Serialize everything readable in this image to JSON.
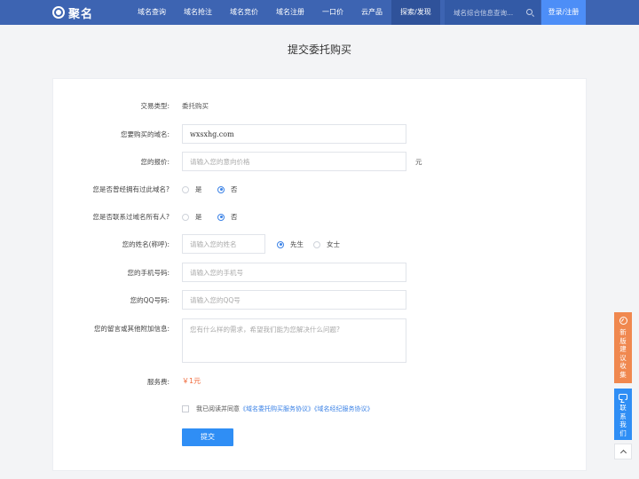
{
  "nav": {
    "logo_text": "聚名",
    "links": [
      "域名查询",
      "域名抢注",
      "域名竞价",
      "域名注册",
      "一口价",
      "云产品",
      "探索/发现"
    ],
    "search_placeholder": "域名综合信息查询...",
    "login_label": "登录/注册"
  },
  "page": {
    "title": "提交委托购买"
  },
  "form": {
    "trade_type_label": "交易类型:",
    "trade_type_value": "委托购买",
    "domain_label": "您要购买的域名:",
    "domain_value": "wxsxhg.com",
    "price_label": "您的报价:",
    "price_placeholder": "请输入您的意向价格",
    "price_unit": "元",
    "owned_label": "您是否曾经拥有过此域名?",
    "owned_options": [
      "是",
      "否"
    ],
    "owned_selected": "否",
    "contacted_label": "您是否联系过域名所有人?",
    "contacted_options": [
      "是",
      "否"
    ],
    "contacted_selected": "否",
    "name_label": "您的姓名(称呼):",
    "name_placeholder": "请输入您的姓名",
    "gender_options": [
      "先生",
      "女士"
    ],
    "gender_selected": "先生",
    "phone_label": "您的手机号码:",
    "phone_placeholder": "请输入您的手机号",
    "qq_label": "您的QQ号码:",
    "qq_placeholder": "请输入您的QQ号",
    "message_label": "您的留言或其他附加信息:",
    "message_placeholder": "您有什么样的需求，希望我们能为您解决什么问题?",
    "fee_label": "服务费:",
    "fee_value": "￥1元",
    "agree_prefix": "我已阅读并同意",
    "agree_link1": "《域名委托购买服务协议》",
    "agree_link2": "《域名经纪服务协议》",
    "agree_checked": false,
    "submit_label": "提交"
  },
  "sidebar_float": {
    "feedback_label": "新版建议收集",
    "contact_label": "联系我们"
  },
  "colors": {
    "nav_bg": "#3d64b2",
    "accent_blue": "#2f8ef5",
    "fee_orange": "#f06a3b",
    "feedback_orange": "#f0884f"
  }
}
